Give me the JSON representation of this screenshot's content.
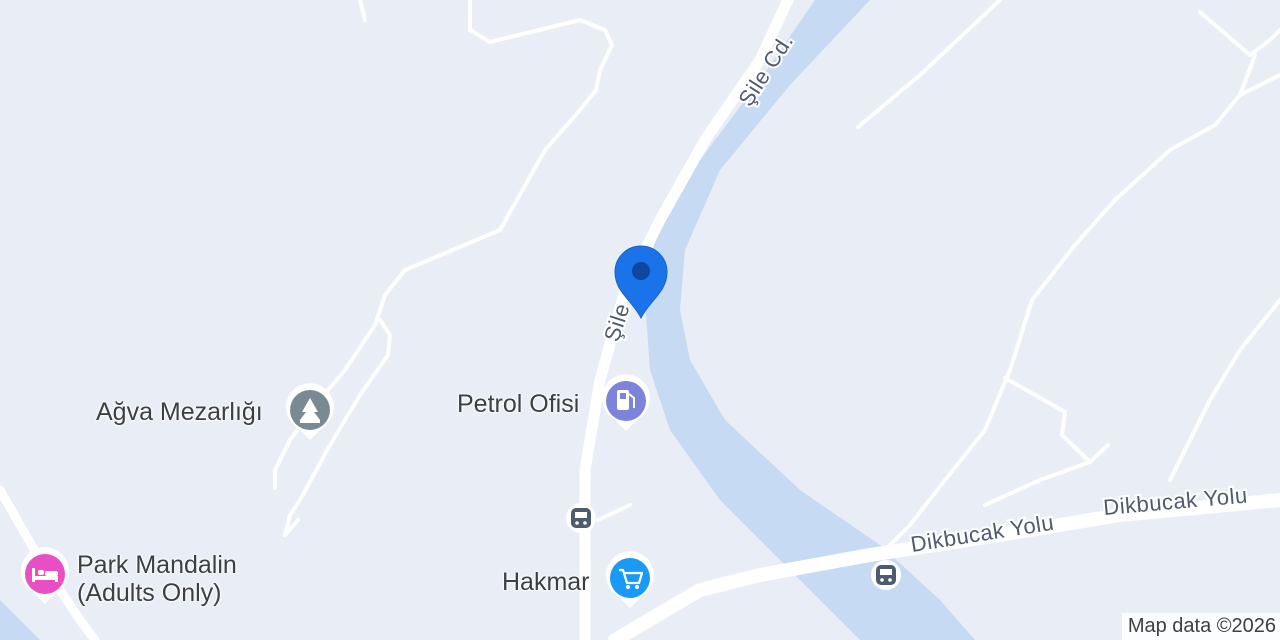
{
  "map": {
    "attribution": "Map data ©2026",
    "colors": {
      "land": "#e9edf5",
      "water": "#c6daf4",
      "road": "#ffffff",
      "pin": "#1a73e8"
    },
    "roads": {
      "main_top": "Şile Cd.",
      "main_mid": "Şile",
      "dikbucak_left": "Dikbucak Yolu",
      "dikbucak_right": "Dikbucak Yolu"
    },
    "pois": {
      "mezarlik": {
        "label": "Ağva Mezarlığı",
        "icon": "cemetery-icon",
        "color": "#7a8a94"
      },
      "petrol": {
        "label": "Petrol Ofisi",
        "icon": "gas-station-icon",
        "color": "#7b84d8"
      },
      "park": {
        "label_line1": "Park Mandalin",
        "label_line2": "(Adults Only)",
        "icon": "hotel-bed-icon",
        "color": "#e94fc4"
      },
      "hakmar": {
        "label": "Hakmar",
        "icon": "shopping-cart-icon",
        "color": "#1a9af5"
      }
    },
    "bus_stops": [
      "bus-stop-icon",
      "bus-stop-icon"
    ]
  }
}
